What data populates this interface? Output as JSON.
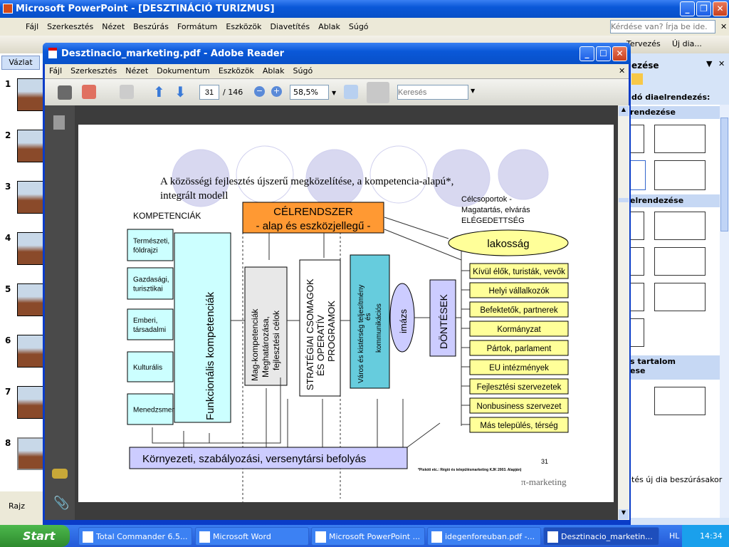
{
  "ppt": {
    "title": "Microsoft PowerPoint - [DESZTINÁCIÓ TURIZMUS]",
    "menu": [
      "Fájl",
      "Szerkesztés",
      "Nézet",
      "Beszúrás",
      "Formátum",
      "Eszközök",
      "Diavetítés",
      "Ablak",
      "Súgó"
    ],
    "help_placeholder": "Kérdése van? Írja be ide.",
    "toolbar_right": [
      "Tervezés",
      "Új dia..."
    ],
    "outline_tab": "Vázlat",
    "slide_numbers": [
      "1",
      "2",
      "3",
      "4",
      "5",
      "6",
      "7",
      "8"
    ],
    "draw_label": "Rajz",
    "taskpane": {
      "title": "ezése",
      "available": "dó diaelrendezés:",
      "section1": "rendezése",
      "section2": "elrendezése",
      "section3": "s tartalom",
      "section3b": "ese",
      "footer": "tés új dia beszúrásakor"
    }
  },
  "reader": {
    "title": "Desztinacio_marketing.pdf - Adobe Reader",
    "menu": [
      "Fájl",
      "Szerkesztés",
      "Nézet",
      "Dokumentum",
      "Eszközök",
      "Ablak",
      "Súgó"
    ],
    "page": "31",
    "total": "/ 146",
    "zoom": "58,5%",
    "search_placeholder": "Keresés"
  },
  "slide": {
    "title1": "A közösségi fejlesztés újszerű megközelítése, a kompetencia-alapú*,",
    "title2": "integrált modell",
    "kompetenciak": "KOMPETENCIÁK",
    "left_boxes": [
      [
        "Természeti,",
        "földrajzi"
      ],
      [
        "Gazdasági,",
        "turisztikai"
      ],
      [
        "Emberi,",
        "társadalmi"
      ],
      [
        "Kulturális"
      ],
      [
        "Menedzsment"
      ]
    ],
    "funkcionalis": "Funkcionális kompetenciák",
    "celrendszer1": "CÉLRENDSZER",
    "celrendszer2": "- alap és eszközjellegű -",
    "mag": [
      "Mag-kompetenciák",
      "Meghatározása,",
      "fejlesztési célok"
    ],
    "strategiai": [
      "STRATÉGIAI CSOMAGOK",
      "ÉS OPERATÍV",
      "PROGRAMOK"
    ],
    "varos": [
      "Város és kistérség teljesítmény",
      "és",
      "kommunikációs"
    ],
    "imazs": "imázs",
    "dontesek": "DÖNTÉSEK",
    "celcsoportok": [
      "Célcsoportok -",
      "Magatartás, elvárás",
      "ELÉGEDETTSÉG"
    ],
    "lakossag": "lakosság",
    "targets": [
      "Kívül élők, turisták, vevők",
      "Helyi vállalkozók",
      "Befektetők, partnerek",
      "Kormányzat",
      "Pártok, parlament",
      "EU intézmények",
      "Fejlesztési szervezetek",
      "Nonbusiness szervezet",
      "Más település, térség"
    ],
    "kornyezeti": "Környezeti, szabályozási, versenytársi befolyás",
    "page_number": "31",
    "footnote": "*Piskóti etc.: Régió és településmarketing KJK 2003. Alapján)",
    "logo": "π-marketing",
    "colors": {
      "orange": "#ff9933",
      "cyan": "#ccffff",
      "teal": "#66ccdd",
      "lavender": "#ccccff",
      "yellow": "#ffff99"
    }
  },
  "taskbar": {
    "start": "Start",
    "items": [
      "Total Commander 6.5...",
      "Microsoft Word",
      "Microsoft PowerPoint ...",
      "idegenforeuban.pdf -...",
      "Desztinacio_marketin..."
    ],
    "lang": "HL",
    "clock": "14:34"
  }
}
